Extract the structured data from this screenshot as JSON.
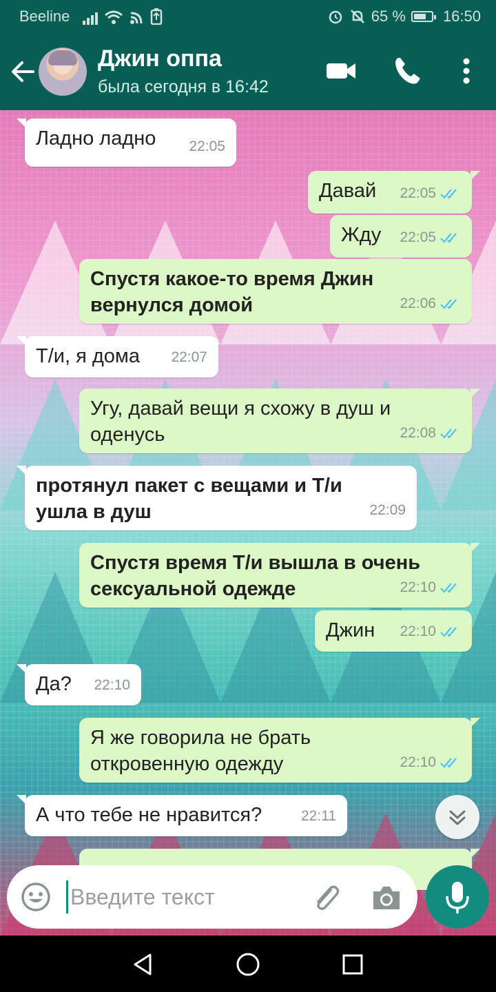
{
  "status_bar": {
    "carrier": "Beeline",
    "battery": "65 %",
    "time": "16:50"
  },
  "header": {
    "name": "Джин оппа",
    "last_seen": "была сегодня в 16:42"
  },
  "messages": [
    {
      "side": "in",
      "text": "Ладно ладно",
      "time": "22:05"
    },
    {
      "side": "out",
      "text": "Давай",
      "time": "22:05",
      "read": true
    },
    {
      "side": "out",
      "text": "Жду",
      "time": "22:05",
      "read": true
    },
    {
      "side": "out",
      "line1": "Спустя какое-то время Джин",
      "line2": "вернулся домой",
      "time": "22:06",
      "read": true,
      "bold": true
    },
    {
      "side": "in",
      "text": "Т/и, я дома",
      "time": "22:07"
    },
    {
      "side": "out",
      "line1": "Угу, давай вещи я схожу в душ и",
      "line2": "оденусь",
      "time": "22:08",
      "read": true
    },
    {
      "side": "in",
      "line1": "протянул пакет с вещами и Т/и",
      "line2": "ушла в душ",
      "time": "22:09",
      "bold": true
    },
    {
      "side": "out",
      "line1": "Спустя время Т/и вышла в очень",
      "line2": "сексуальной одежде",
      "time": "22:10",
      "read": true,
      "bold": true
    },
    {
      "side": "out",
      "text": "Джин",
      "time": "22:10",
      "read": true
    },
    {
      "side": "in",
      "text": "Да?",
      "time": "22:10"
    },
    {
      "side": "out",
      "line1": "Я же говорила не брать",
      "line2": "откровенную одежду",
      "time": "22:10",
      "read": true
    },
    {
      "side": "in",
      "text": "А что тебе не нравится?",
      "time": "22:11"
    }
  ],
  "input": {
    "placeholder": "Введите текст"
  },
  "icons": {
    "back": "arrow-left-icon",
    "video": "video-call-icon",
    "call": "phone-icon",
    "menu": "more-vert-icon",
    "emoji": "emoji-icon",
    "attach": "paperclip-icon",
    "camera": "camera-icon",
    "mic": "microphone-icon",
    "scroll": "chevrons-down-icon",
    "read": "double-check-icon"
  },
  "colors": {
    "header": "#075e54",
    "outgoing": "#dcf8c6",
    "incoming": "#ffffff",
    "accent": "#128c7e",
    "read_ticks": "#4fc3f7"
  }
}
